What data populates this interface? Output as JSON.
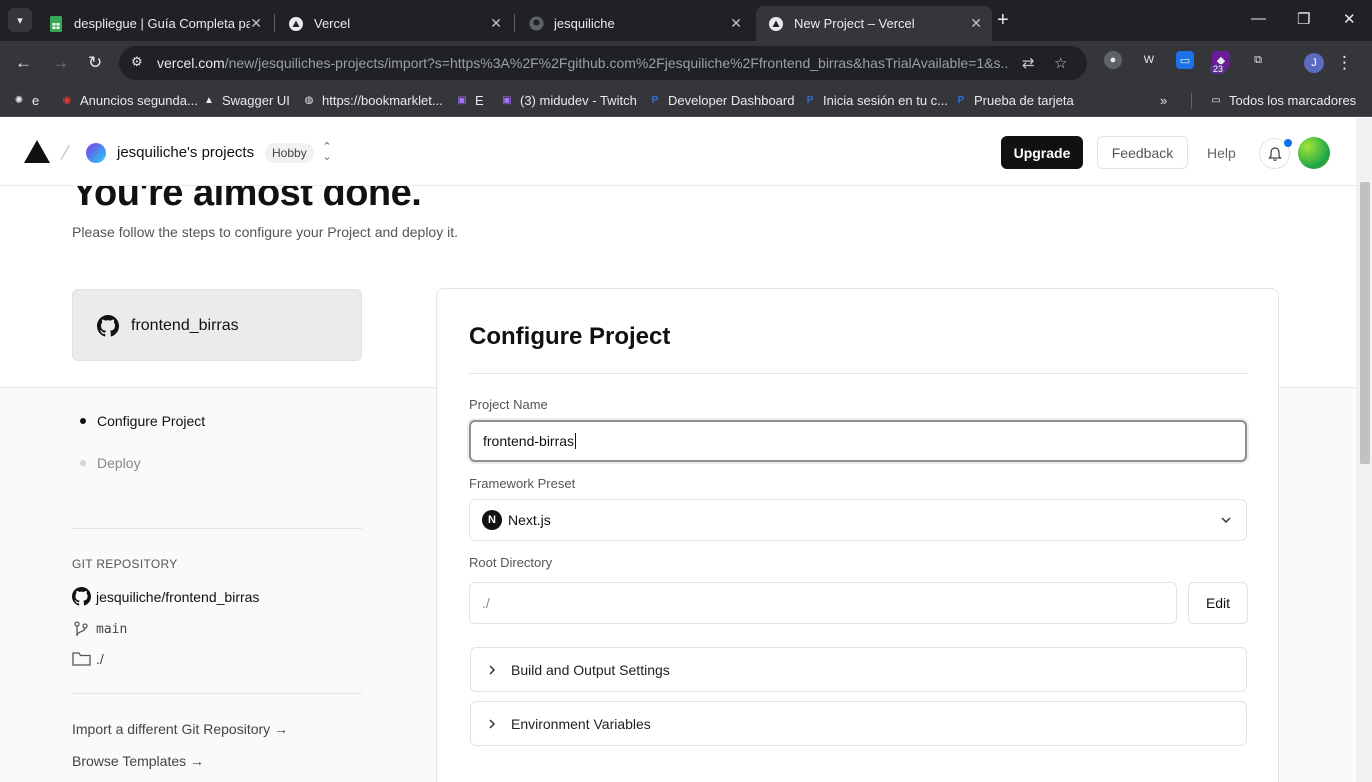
{
  "browser": {
    "tabs": [
      {
        "title": "despliegue | Guía Completa par",
        "active": false
      },
      {
        "title": "Vercel",
        "active": false
      },
      {
        "title": "jesquiliche",
        "active": false
      },
      {
        "title": "New Project – Vercel",
        "active": true
      }
    ],
    "url_host": "vercel.com",
    "url_path": "/new/jesquiliches-projects/import?s=https%3A%2F%2Fgithub.com%2Fjesquiliche%2Ffrontend_birras&hasTrialAvailable=1&s...",
    "profile_initial": "J",
    "extension_badge": "23",
    "bookmarks": [
      {
        "label": "e",
        "icon": "chatgpt-icon"
      },
      {
        "label": "Anuncios segunda...",
        "icon": "site-icon"
      },
      {
        "label": "Swagger UI",
        "icon": "vercel-icon"
      },
      {
        "label": "https://bookmarklet...",
        "icon": "globe-icon"
      },
      {
        "label": "E",
        "icon": "twitch-icon"
      },
      {
        "label": "(3) midudev - Twitch",
        "icon": "twitch-icon"
      },
      {
        "label": "Developer Dashboard",
        "icon": "paypal-icon"
      },
      {
        "label": "Inicia sesión en tu c...",
        "icon": "paypal-icon"
      },
      {
        "label": "Prueba de tarjeta",
        "icon": "paypal-icon"
      }
    ],
    "all_bookmarks": "Todos los marcadores"
  },
  "header": {
    "team_name": "jesquiliche's projects",
    "plan": "Hobby",
    "upgrade": "Upgrade",
    "feedback": "Feedback",
    "help": "Help"
  },
  "hero": {
    "title": "You're almost done.",
    "subtitle": "Please follow the steps to configure your Project and deploy it."
  },
  "sidebar": {
    "repo_card_name": "frontend_birras",
    "steps": [
      {
        "label": "Configure Project",
        "active": true
      },
      {
        "label": "Deploy",
        "active": false
      }
    ],
    "git_section_label": "GIT REPOSITORY",
    "repo_full_name": "jesquiliche/frontend_birras",
    "branch": "main",
    "directory": "./",
    "import_link": "Import a different Git Repository →",
    "templates_link": "Browse Templates →"
  },
  "config": {
    "title": "Configure Project",
    "project_name_label": "Project Name",
    "project_name_value": "frontend-birras",
    "framework_label": "Framework Preset",
    "framework_value": "Next.js",
    "framework_icon_letter": "N",
    "root_label": "Root Directory",
    "root_value": "./",
    "edit": "Edit",
    "build_settings": "Build and Output Settings",
    "env_vars": "Environment Variables"
  },
  "colors": {
    "primary": "#111111",
    "notification": "#0a72ef",
    "chrome_dark": "#202124",
    "chrome_toolbar": "#35363a"
  }
}
